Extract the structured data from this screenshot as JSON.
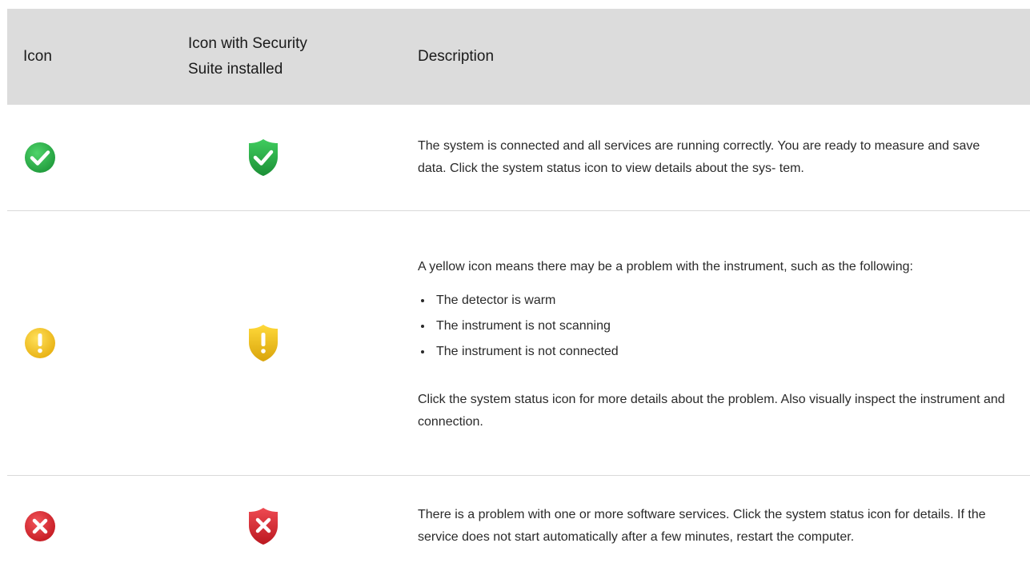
{
  "header": {
    "col_icon": "Icon",
    "col_security_line1": "Icon with Security",
    "col_security_line2": "Suite installed",
    "col_description": "Description"
  },
  "rows": [
    {
      "status": "ok",
      "icon_name": "check-circle-icon",
      "security_icon_name": "check-shield-icon",
      "color": "#2db04b",
      "description": "The system is connected and all services are running correctly. You are ready to measure and save data. Click the system status icon to view details about the sys- tem."
    },
    {
      "status": "warning",
      "icon_name": "exclamation-circle-icon",
      "security_icon_name": "exclamation-shield-icon",
      "color": "#f0c020",
      "description": "A yellow icon means there may be a problem with the instrument, such as the following:",
      "bullets": [
        "The detector is warm",
        "The instrument is not scanning",
        "The instrument is not connected"
      ],
      "followup": "Click the system status icon for more details about the problem. Also visually inspect the instrument and connection."
    },
    {
      "status": "error",
      "icon_name": "x-circle-icon",
      "security_icon_name": "x-shield-icon",
      "color": "#d8262e",
      "description": "There is a problem with one or more software services. Click the system status icon for details. If the service does not start automatically after a few minutes, restart the computer."
    }
  ]
}
